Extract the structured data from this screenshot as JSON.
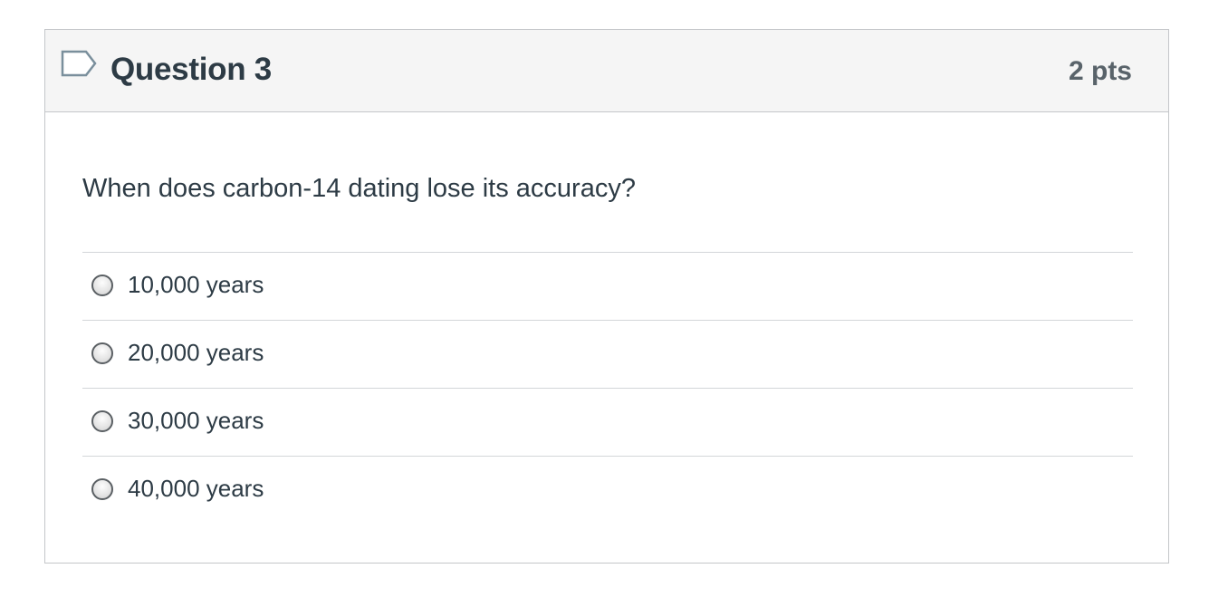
{
  "question": {
    "title": "Question 3",
    "points": "2 pts",
    "text": "When does carbon-14 dating lose its accuracy?",
    "flag_icon": "flag-outline-icon"
  },
  "answers": [
    {
      "label": "10,000 years",
      "selected": false
    },
    {
      "label": "20,000 years",
      "selected": false
    },
    {
      "label": "30,000 years",
      "selected": false
    },
    {
      "label": "40,000 years",
      "selected": false
    }
  ],
  "colors": {
    "header_bg": "#f5f5f5",
    "text": "#2d3b45",
    "points_text": "#59636a",
    "border": "#c4c6c9",
    "flag_outline": "#7a8f9c"
  }
}
